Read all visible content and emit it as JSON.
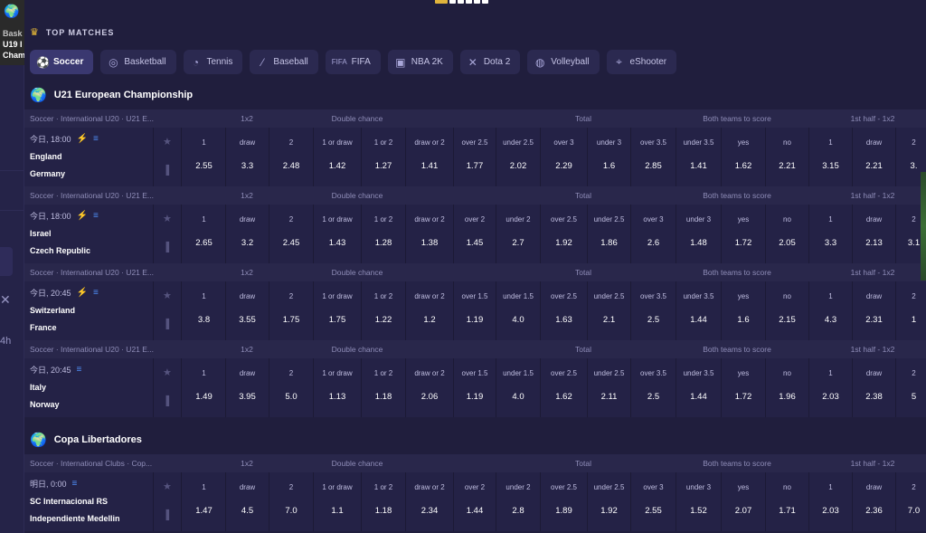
{
  "promo": {
    "line1": "Bask",
    "line2": "U19 I",
    "line3": "Cham"
  },
  "left_nav": {
    "close": "✕",
    "countdown": "4h"
  },
  "top_matches_title": "TOP MATCHES",
  "sport_tabs": [
    {
      "label": "Soccer",
      "icon": "soccer-ball-icon",
      "active": true
    },
    {
      "label": "Basketball",
      "icon": "basketball-icon"
    },
    {
      "label": "Tennis",
      "icon": "tennis-icon"
    },
    {
      "label": "Baseball",
      "icon": "baseball-bat-icon"
    },
    {
      "label": "FIFA",
      "icon": "fifa-logo-icon",
      "icon_text": "FIFA"
    },
    {
      "label": "NBA 2K",
      "icon": "nba2k-logo-icon"
    },
    {
      "label": "Dota 2",
      "icon": "dota2-icon"
    },
    {
      "label": "Volleyball",
      "icon": "volleyball-icon"
    },
    {
      "label": "eShooter",
      "icon": "eshooter-icon"
    }
  ],
  "leagues": [
    {
      "name": "U21 European Championship",
      "icon": "globe-icon"
    },
    {
      "name": "Copa Libertadores",
      "icon": "globe-icon"
    }
  ],
  "matches": [
    {
      "path": "Soccer · International U20 · U21 E...",
      "time": "今日, 18:00",
      "bolt": true,
      "stream": true,
      "team1": "England",
      "team2": "Germany",
      "groups": [
        "1x2",
        "Double chance",
        "Total",
        "Both teams to score",
        "1st half - 1x2"
      ],
      "labels": [
        "1",
        "draw",
        "2",
        "1 or draw",
        "1 or 2",
        "draw or 2",
        "over 2.5",
        "under 2.5",
        "over 3",
        "under 3",
        "over 3.5",
        "under 3.5",
        "yes",
        "no",
        "1",
        "draw",
        "2"
      ],
      "values": [
        "2.55",
        "3.3",
        "2.48",
        "1.42",
        "1.27",
        "1.41",
        "1.77",
        "2.02",
        "2.29",
        "1.6",
        "2.85",
        "1.41",
        "1.62",
        "2.21",
        "3.15",
        "2.21",
        "3."
      ]
    },
    {
      "path": "Soccer · International U20 · U21 E...",
      "time": "今日, 18:00",
      "bolt": true,
      "stream": true,
      "team1": "Israel",
      "team2": "Czech Republic",
      "groups": [
        "1x2",
        "Double chance",
        "Total",
        "Both teams to score",
        "1st half - 1x2"
      ],
      "labels": [
        "1",
        "draw",
        "2",
        "1 or draw",
        "1 or 2",
        "draw or 2",
        "over 2",
        "under 2",
        "over 2.5",
        "under 2.5",
        "over 3",
        "under 3",
        "yes",
        "no",
        "1",
        "draw",
        "2"
      ],
      "values": [
        "2.65",
        "3.2",
        "2.45",
        "1.43",
        "1.28",
        "1.38",
        "1.45",
        "2.7",
        "1.92",
        "1.86",
        "2.6",
        "1.48",
        "1.72",
        "2.05",
        "3.3",
        "2.13",
        "3.1"
      ]
    },
    {
      "path": "Soccer · International U20 · U21 E...",
      "time": "今日, 20:45",
      "bolt": true,
      "stream": true,
      "team1": "Switzerland",
      "team2": "France",
      "groups": [
        "1x2",
        "Double chance",
        "Total",
        "Both teams to score",
        "1st half - 1x2"
      ],
      "labels": [
        "1",
        "draw",
        "2",
        "1 or draw",
        "1 or 2",
        "draw or 2",
        "over 1.5",
        "under 1.5",
        "over 2.5",
        "under 2.5",
        "over 3.5",
        "under 3.5",
        "yes",
        "no",
        "1",
        "draw",
        "2"
      ],
      "values": [
        "3.8",
        "3.55",
        "1.75",
        "1.75",
        "1.22",
        "1.2",
        "1.19",
        "4.0",
        "1.63",
        "2.1",
        "2.5",
        "1.44",
        "1.6",
        "2.15",
        "4.3",
        "2.31",
        "1"
      ]
    },
    {
      "path": "Soccer · International U20 · U21 E...",
      "time": "今日, 20:45",
      "bolt": false,
      "stream": true,
      "team1": "Italy",
      "team2": "Norway",
      "groups": [
        "1x2",
        "Double chance",
        "Total",
        "Both teams to score",
        "1st half - 1x2"
      ],
      "labels": [
        "1",
        "draw",
        "2",
        "1 or draw",
        "1 or 2",
        "draw or 2",
        "over 1.5",
        "under 1.5",
        "over 2.5",
        "under 2.5",
        "over 3.5",
        "under 3.5",
        "yes",
        "no",
        "1",
        "draw",
        "2"
      ],
      "values": [
        "1.49",
        "3.95",
        "5.0",
        "1.13",
        "1.18",
        "2.06",
        "1.19",
        "4.0",
        "1.62",
        "2.11",
        "2.5",
        "1.44",
        "1.72",
        "1.96",
        "2.03",
        "2.38",
        "5"
      ]
    },
    {
      "path": "Soccer · International Clubs · Cop...",
      "time": "明日, 0:00",
      "bolt": false,
      "stream": true,
      "team1": "SC Internacional RS",
      "team2": "Independiente Medellin",
      "groups": [
        "1x2",
        "Double chance",
        "Total",
        "Both teams to score",
        "1st half - 1x2"
      ],
      "labels": [
        "1",
        "draw",
        "2",
        "1 or draw",
        "1 or 2",
        "draw or 2",
        "over 2",
        "under 2",
        "over 2.5",
        "under 2.5",
        "over 3",
        "under 3",
        "yes",
        "no",
        "1",
        "draw",
        "2"
      ],
      "values": [
        "1.47",
        "4.5",
        "7.0",
        "1.1",
        "1.18",
        "2.34",
        "1.44",
        "2.8",
        "1.89",
        "1.92",
        "2.55",
        "1.52",
        "2.07",
        "1.71",
        "2.03",
        "2.36",
        "7.0"
      ]
    }
  ]
}
